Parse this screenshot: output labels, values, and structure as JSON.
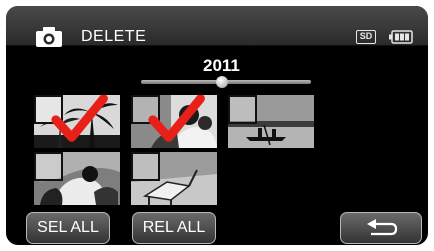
{
  "header": {
    "title": "DELETE",
    "mode_icon": "camera-icon",
    "media_label": "SD",
    "battery_icon": "battery-icon"
  },
  "timeline": {
    "year": "2011"
  },
  "thumbnails": [
    {
      "name": "thumb-1",
      "scene": "palm trees",
      "checked": true
    },
    {
      "name": "thumb-2",
      "scene": "family portrait",
      "checked": true
    },
    {
      "name": "thumb-3",
      "scene": "canoe on lake",
      "checked": false
    },
    {
      "name": "thumb-4",
      "scene": "dog and children",
      "checked": false
    },
    {
      "name": "thumb-5",
      "scene": "deck chair",
      "checked": false
    }
  ],
  "buttons": {
    "select_all": "SEL ALL",
    "release_all": "REL ALL",
    "back_icon": "return-arrow-icon"
  },
  "colors": {
    "check": "#e8201a",
    "screen_bg": "#000000",
    "header_bg": "#3a3a3a"
  }
}
